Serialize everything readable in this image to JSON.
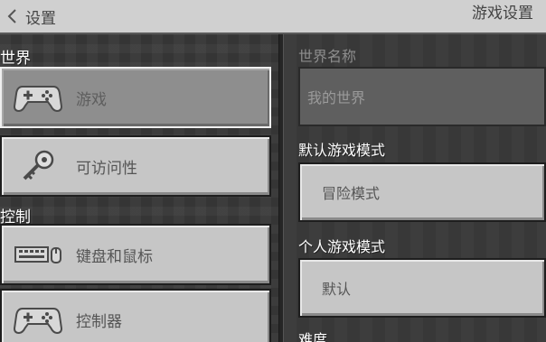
{
  "header": {
    "back_label": "设置",
    "title": "游戏设置"
  },
  "sidebar": {
    "sections": [
      {
        "label": "世界"
      },
      {
        "label": "控制"
      }
    ],
    "items": [
      {
        "label": "游戏",
        "icon": "controller-icon",
        "selected": true
      },
      {
        "label": "可访问性",
        "icon": "key-icon",
        "selected": false
      },
      {
        "label": "键盘和鼠标",
        "icon": "keyboard-mouse-icon",
        "selected": false
      },
      {
        "label": "控制器",
        "icon": "controller-icon",
        "selected": false
      }
    ]
  },
  "main": {
    "world_name": {
      "label": "世界名称",
      "value": "我的世界"
    },
    "default_game_mode": {
      "label": "默认游戏模式",
      "value": "冒险模式"
    },
    "personal_game_mode": {
      "label": "个人游戏模式",
      "value": "默认"
    },
    "difficulty": {
      "label": "难度"
    }
  }
}
